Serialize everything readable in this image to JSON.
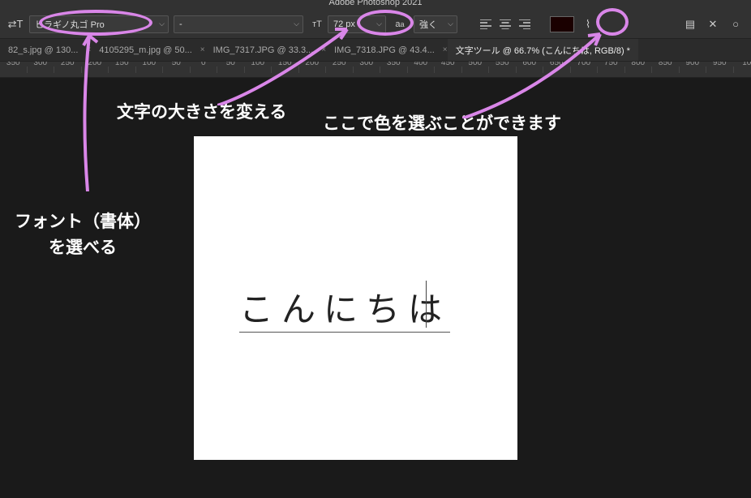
{
  "app_title": "Adobe Photoshop 2021",
  "options_bar": {
    "font_family": "ヒラギノ丸ゴ Pro",
    "font_style": "-",
    "font_size": "72 px",
    "aa_label": "強く"
  },
  "tabs": [
    {
      "label": "82_s.jpg @ 130..."
    },
    {
      "label": "4105295_m.jpg @ 50..."
    },
    {
      "label": "IMG_7317.JPG @ 33.3..."
    },
    {
      "label": "IMG_7318.JPG @ 43.4..."
    },
    {
      "label": "文字ツール @ 66.7% (こんにちは, RGB/8) *"
    }
  ],
  "ruler_values": [
    "350",
    "300",
    "250",
    "200",
    "150",
    "100",
    "50",
    "0",
    "50",
    "100",
    "150",
    "200",
    "250",
    "300",
    "350",
    "400",
    "450",
    "500",
    "550",
    "600",
    "650",
    "700",
    "750",
    "800",
    "850",
    "900",
    "950",
    "10"
  ],
  "canvas_text": "こんにちは",
  "annotations": {
    "size": "文字の大きさを変える",
    "color": "ここで色を選ぶことができます",
    "font": "フォント（書体）\nを選べる"
  }
}
